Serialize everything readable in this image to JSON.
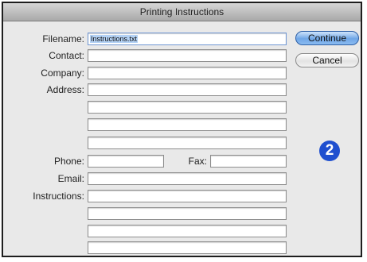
{
  "window": {
    "title": "Printing Instructions"
  },
  "form": {
    "filename": {
      "label": "Filename:",
      "value": "Instructions.txt"
    },
    "contact": {
      "label": "Contact:",
      "value": ""
    },
    "company": {
      "label": "Company:",
      "value": ""
    },
    "address": {
      "label": "Address:",
      "lines": [
        "",
        "",
        "",
        ""
      ]
    },
    "phone": {
      "label": "Phone:",
      "value": ""
    },
    "fax": {
      "label": "Fax:",
      "value": ""
    },
    "email": {
      "label": "Email:",
      "value": ""
    },
    "instructions": {
      "label": "Instructions:",
      "lines": [
        "",
        "",
        "",
        "",
        ""
      ]
    }
  },
  "buttons": {
    "continue": "Continue",
    "cancel": "Cancel"
  },
  "badge": {
    "number": "2",
    "color": "#1f4fcf"
  },
  "colors": {
    "default_button": "#6fa6e6",
    "selection": "#b4d2f5"
  }
}
